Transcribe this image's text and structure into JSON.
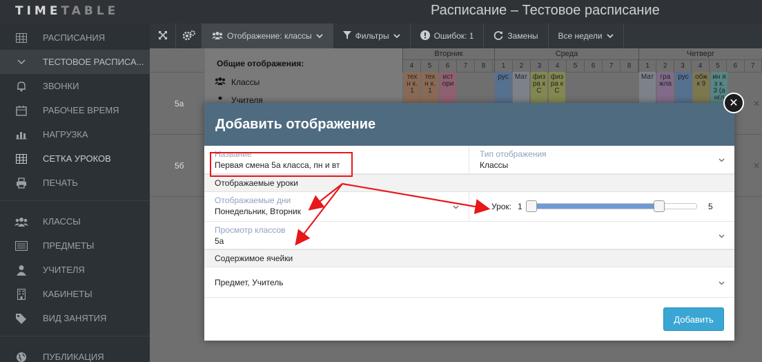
{
  "app": {
    "logo_part1": "TIME",
    "logo_part2": "TABLE",
    "page_title": "Расписание – Тестовое расписание"
  },
  "sidebar": {
    "items": [
      {
        "label": "РАСПИСАНИЯ",
        "icon": "table-icon"
      },
      {
        "label": "ТЕСТОВОЕ РАСПИСА...",
        "icon": "chevron-down-icon"
      },
      {
        "label": "ЗВОНКИ",
        "icon": "bell-icon"
      },
      {
        "label": "РАБОЧЕЕ ВРЕМЯ",
        "icon": "calendar-icon"
      },
      {
        "label": "НАГРУЗКА",
        "icon": "bar-chart-icon"
      },
      {
        "label": "СЕТКА УРОКОВ",
        "icon": "grid-icon"
      },
      {
        "label": "ПЕЧАТЬ",
        "icon": "printer-icon"
      },
      {
        "label": "КЛАССЫ",
        "icon": "users-icon"
      },
      {
        "label": "ПРЕДМЕТЫ",
        "icon": "list-icon"
      },
      {
        "label": "УЧИТЕЛЯ",
        "icon": "user-icon"
      },
      {
        "label": "КАБИНЕТЫ",
        "icon": "building-icon"
      },
      {
        "label": "ВИД ЗАНЯТИЯ",
        "icon": "tags-icon"
      },
      {
        "label": "ПУБЛИКАЦИЯ",
        "icon": "globe-icon"
      }
    ]
  },
  "toolbar": {
    "display_label": "Отображение: классы",
    "filters_label": "Фильтры",
    "errors_label": "Ошибок: 1",
    "replacements_label": "Замены",
    "weeks_label": "Все недели"
  },
  "schedule": {
    "rows": [
      "5а",
      "5б"
    ],
    "days": [
      {
        "name": "Вторник",
        "nums": [
          "4",
          "5",
          "6",
          "7",
          "8"
        ]
      },
      {
        "name": "Среда",
        "nums": [
          "1",
          "2",
          "3",
          "4",
          "5",
          "6",
          "7",
          "8"
        ]
      },
      {
        "name": "Четверг",
        "nums": [
          "1",
          "2",
          "3",
          "4",
          "5",
          "6",
          "7"
        ]
      }
    ],
    "cells": [
      {
        "text": "тех н к. 1",
        "color": "#d9a07a"
      },
      {
        "text": "тех н к. 1",
        "color": "#d9a07a"
      },
      {
        "text": "ист ори",
        "color": "#e58fb0"
      },
      {
        "text": "рус",
        "color": "#7fa6db"
      },
      {
        "text": "Мат",
        "color": "#b9c0cc"
      },
      {
        "text": "физ ра к С",
        "color": "#c9cf6e"
      },
      {
        "text": "физ ра к С",
        "color": "#c9cf6e"
      },
      {
        "text": "Мат",
        "color": "#b9c0cc"
      },
      {
        "text": "гра жла",
        "color": "#c59ad0"
      },
      {
        "text": "рус",
        "color": "#7fa6db"
      },
      {
        "text": "обж к 9",
        "color": "#b9b06a"
      },
      {
        "text": "ин я з к. 3 (а нгл",
        "color": "#7ec6c4"
      }
    ]
  },
  "dropdown": {
    "title": "Общие отображения:",
    "item1": "Классы",
    "item2": "Учителя"
  },
  "modal": {
    "title": "Добавить отображение",
    "name_label": "Название",
    "name_value": "Первая смена 5а класса, пн и вт",
    "type_label": "Тип отображения",
    "type_value": "Классы",
    "section_lessons": "Отображаемые уроки",
    "days_label": "Отображаемые дни",
    "days_value": "Понедельник, Вторник",
    "lesson_label": "Урок:",
    "lesson_min": "1",
    "lesson_max": "5",
    "lesson_range": [
      1,
      5
    ],
    "classes_label": "Просмотр классов",
    "classes_value": "5а",
    "section_content": "Содержимое ячейки",
    "content_value": "Предмет, Учитель",
    "add_button": "Добавить"
  }
}
